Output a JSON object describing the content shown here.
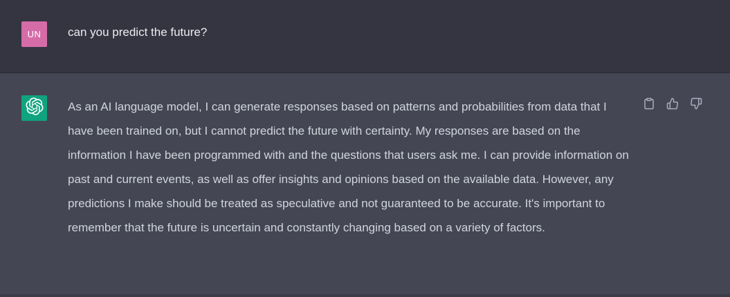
{
  "user_message": {
    "avatar_initials": "UN",
    "avatar_color": "#d56ca8",
    "text": "can you predict the future?"
  },
  "assistant_message": {
    "avatar_icon": "openai-logo-icon",
    "avatar_color": "#10a37f",
    "text": "As an AI language model, I can generate responses based on patterns and probabilities from data that I have been trained on, but I cannot predict the future with certainty. My responses are based on the information I have been programmed with and the questions that users ask me. I can provide information on past and current events, as well as offer insights and opinions based on the available data. However, any predictions I make should be treated as speculative and not guaranteed to be accurate. It's important to remember that the future is uncertain and constantly changing based on a variety of factors.",
    "actions": [
      "copy-icon",
      "thumbs-up-icon",
      "thumbs-down-icon"
    ]
  },
  "colors": {
    "user_row_bg": "#343541",
    "assistant_row_bg": "#444654",
    "user_text": "#ececf1",
    "assistant_text": "#d1d5db",
    "icon_color": "#acacbe"
  }
}
